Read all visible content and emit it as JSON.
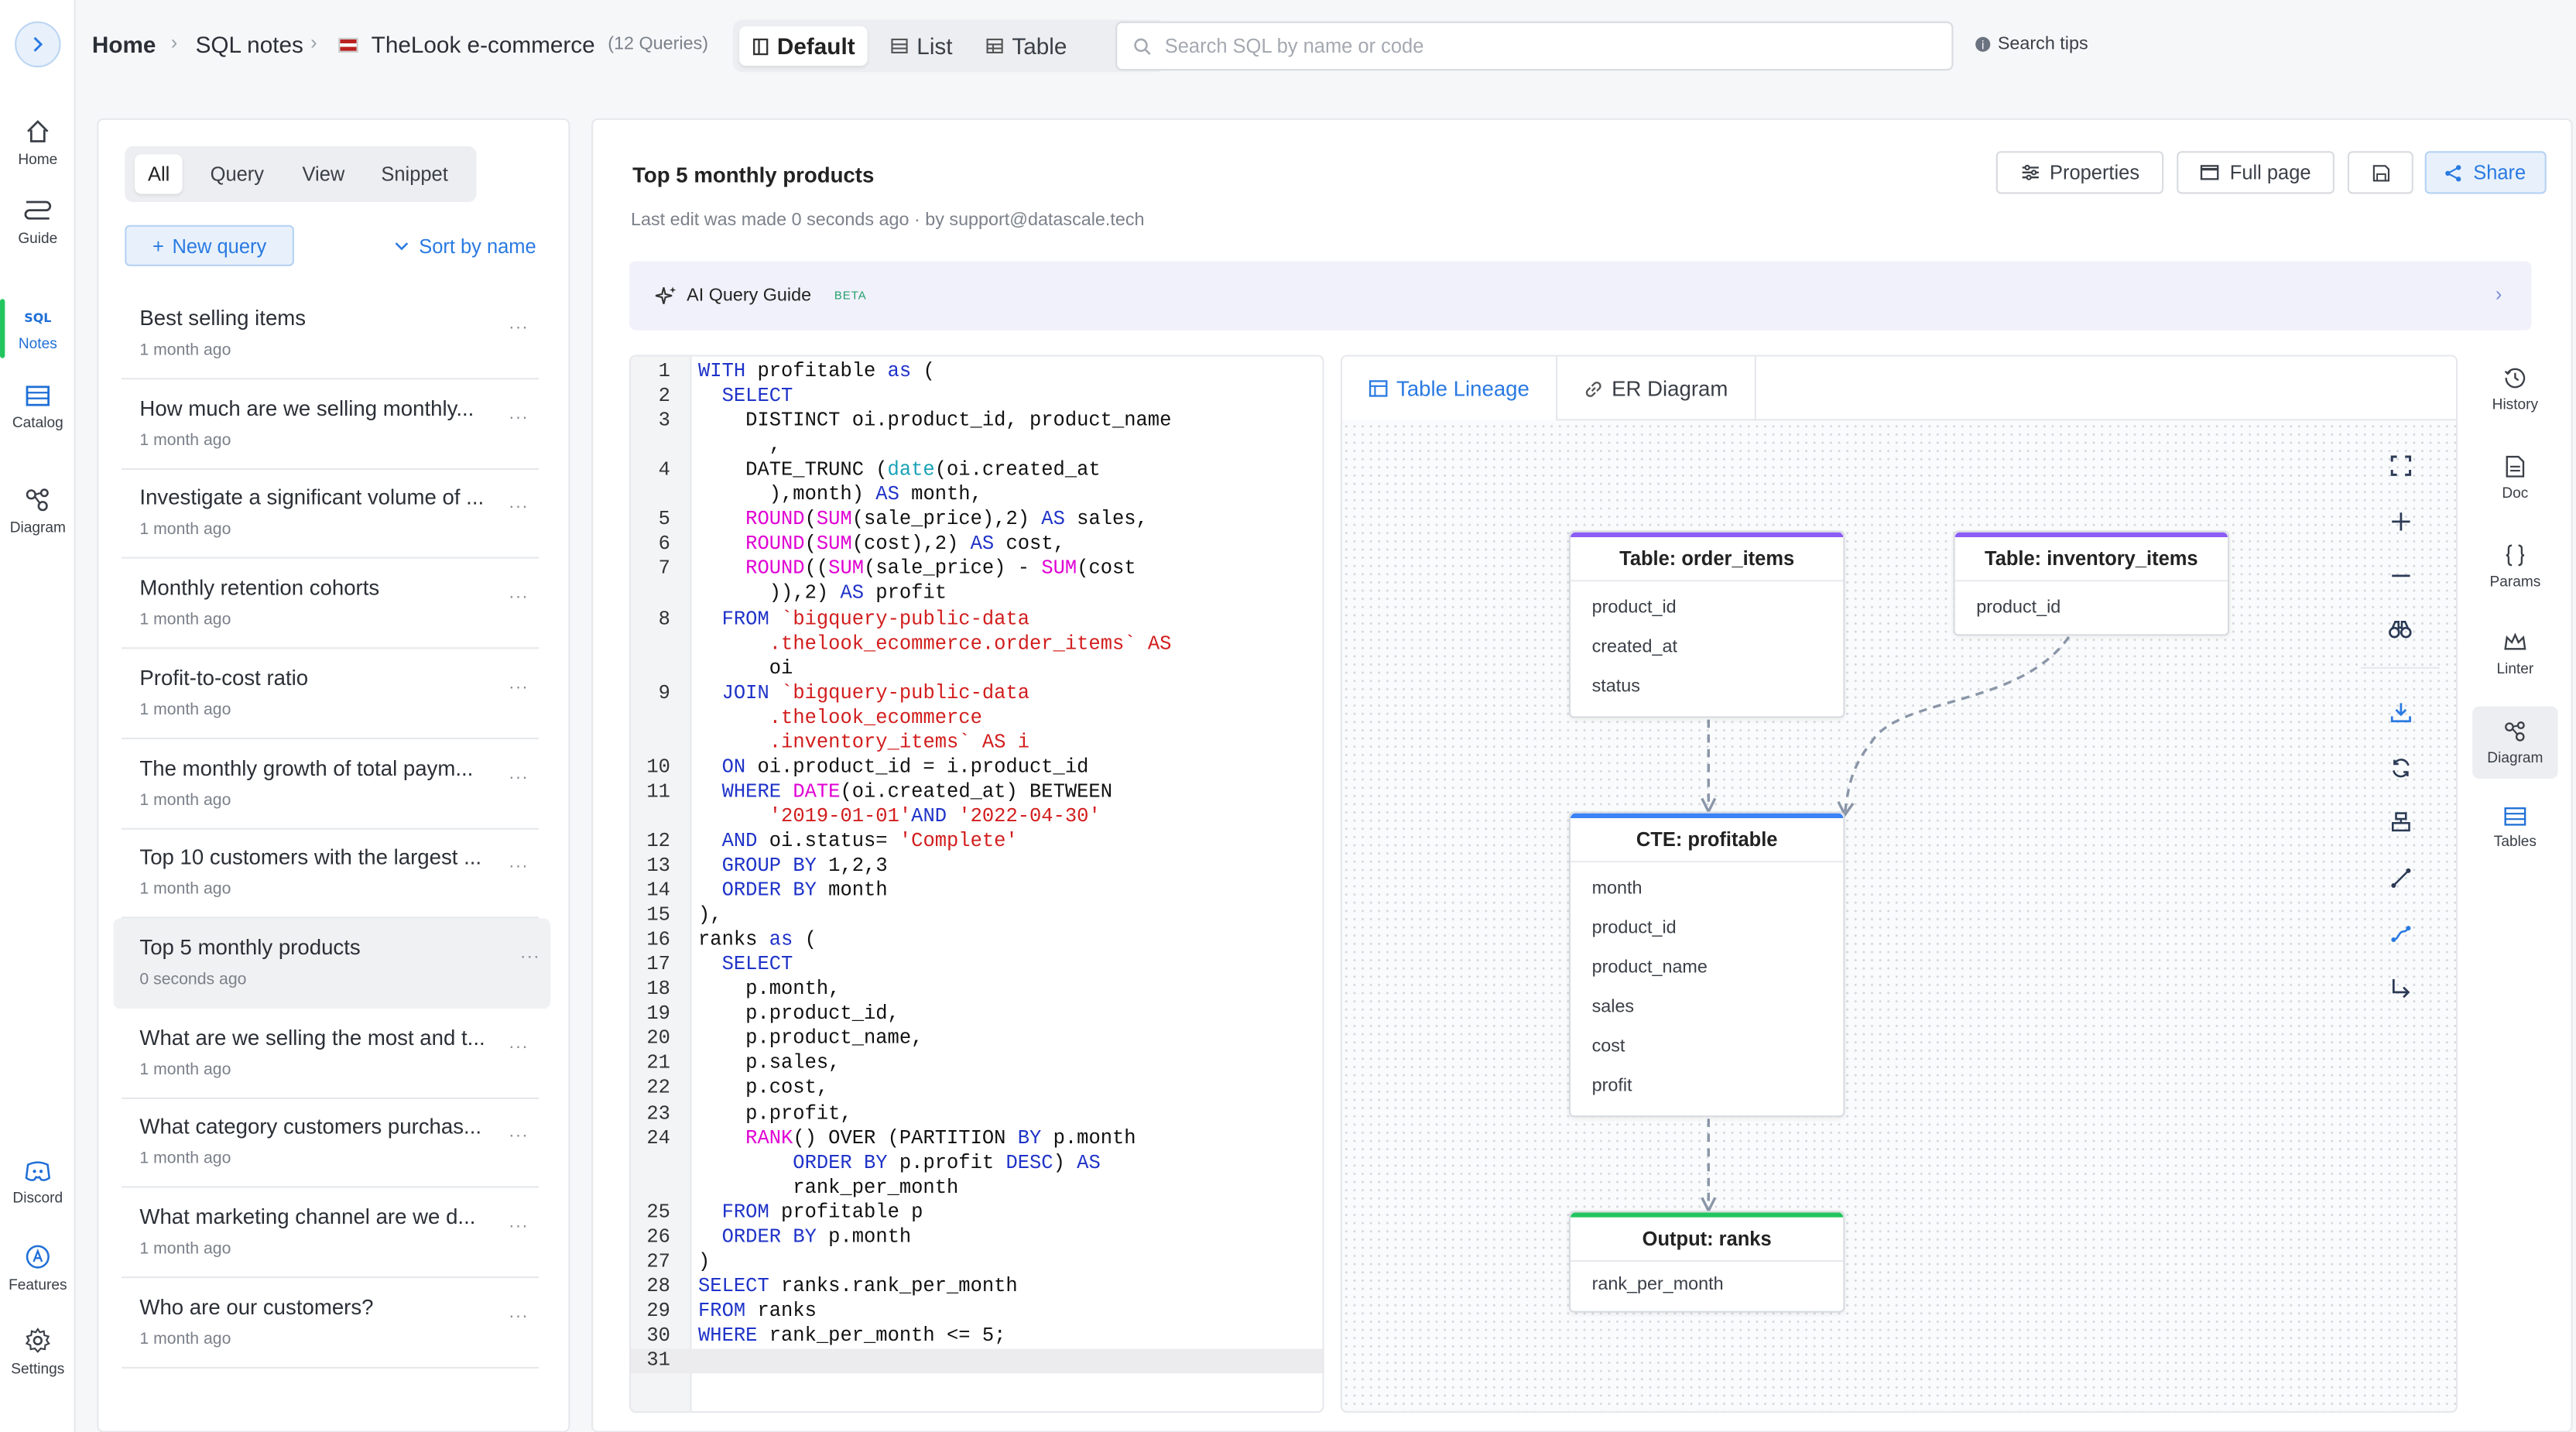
{
  "rail": {
    "items": [
      {
        "label": "Home"
      },
      {
        "label": "Guide"
      },
      {
        "label": "Notes"
      },
      {
        "label": "Catalog"
      },
      {
        "label": "Diagram"
      },
      {
        "label": "Discord"
      },
      {
        "label": "Features"
      },
      {
        "label": "Settings"
      }
    ],
    "notes_icon_text": "SQL"
  },
  "breadcrumb": {
    "home": "Home",
    "section": "SQL notes",
    "project": "TheLook e-commerce",
    "count": "(12 Queries)"
  },
  "views": {
    "default": "Default",
    "list": "List",
    "table": "Table"
  },
  "search": {
    "placeholder": "Search SQL by name or code",
    "tips": "Search tips"
  },
  "filters": {
    "all": "All",
    "query": "Query",
    "view": "View",
    "snippet": "Snippet"
  },
  "list": {
    "new_query": "New query",
    "sort": "Sort by name",
    "more": "...",
    "items": [
      {
        "title": "Best selling items",
        "time": "1 month ago"
      },
      {
        "title": "How much are we selling monthly...",
        "time": "1 month ago"
      },
      {
        "title": "Investigate a significant volume of ...",
        "time": "1 month ago"
      },
      {
        "title": "Monthly retention cohorts",
        "time": "1 month ago"
      },
      {
        "title": "Profit-to-cost ratio",
        "time": "1 month ago"
      },
      {
        "title": "The monthly growth of total paym...",
        "time": "1 month ago"
      },
      {
        "title": "Top 10 customers with the largest ...",
        "time": "1 month ago"
      },
      {
        "title": "Top 5 monthly products",
        "time": "0 seconds ago"
      },
      {
        "title": "What are we selling the most and t...",
        "time": "1 month ago"
      },
      {
        "title": "What category customers purchas...",
        "time": "1 month ago"
      },
      {
        "title": "What marketing channel are we d...",
        "time": "1 month ago"
      },
      {
        "title": "Who are our customers?",
        "time": "1 month ago"
      }
    ]
  },
  "query": {
    "title": "Top 5 monthly products",
    "last_edit": "Last edit was made 0 seconds ago · by support@datascale.tech",
    "properties": "Properties",
    "full_page": "Full page",
    "share": "Share"
  },
  "ai": {
    "label": "AI Query Guide",
    "badge": "BETA"
  },
  "code": {
    "current_line": "31",
    "lines": [
      {
        "n": "1",
        "t": "WITH profitable as ("
      },
      {
        "n": "2",
        "t": "  SELECT"
      },
      {
        "n": "3",
        "t": "    DISTINCT oi.product_id, product_name"
      },
      {
        "n": "",
        "t": "      ,"
      },
      {
        "n": "4",
        "t": "    DATE_TRUNC (date(oi.created_at"
      },
      {
        "n": "",
        "t": "      ),month) AS month,"
      },
      {
        "n": "5",
        "t": "    ROUND(SUM(sale_price),2) AS sales,"
      },
      {
        "n": "6",
        "t": "    ROUND(SUM(cost),2) AS cost,"
      },
      {
        "n": "7",
        "t": "    ROUND((SUM(sale_price) - SUM(cost"
      },
      {
        "n": "",
        "t": "      )),2) AS profit"
      },
      {
        "n": "8",
        "t": "  FROM `bigquery-public-data"
      },
      {
        "n": "",
        "t": "      .thelook_ecommerce.order_items` AS"
      },
      {
        "n": "",
        "t": "      oi"
      },
      {
        "n": "9",
        "t": "  JOIN `bigquery-public-data"
      },
      {
        "n": "",
        "t": "      .thelook_ecommerce"
      },
      {
        "n": "",
        "t": "      .inventory_items` AS i"
      },
      {
        "n": "10",
        "t": "  ON oi.product_id = i.product_id"
      },
      {
        "n": "11",
        "t": "  WHERE DATE(oi.created_at) BETWEEN"
      },
      {
        "n": "",
        "t": "      '2019-01-01'AND '2022-04-30'"
      },
      {
        "n": "12",
        "t": "  AND oi.status= 'Complete'"
      },
      {
        "n": "13",
        "t": "  GROUP BY 1,2,3"
      },
      {
        "n": "14",
        "t": "  ORDER BY month"
      },
      {
        "n": "15",
        "t": "),"
      },
      {
        "n": "16",
        "t": "ranks as ("
      },
      {
        "n": "17",
        "t": "  SELECT"
      },
      {
        "n": "18",
        "t": "    p.month,"
      },
      {
        "n": "19",
        "t": "    p.product_id,"
      },
      {
        "n": "20",
        "t": "    p.product_name,"
      },
      {
        "n": "21",
        "t": "    p.sales,"
      },
      {
        "n": "22",
        "t": "    p.cost,"
      },
      {
        "n": "23",
        "t": "    p.profit,"
      },
      {
        "n": "24",
        "t": "    RANK() OVER (PARTITION BY p.month"
      },
      {
        "n": "",
        "t": "        ORDER BY p.profit DESC) AS"
      },
      {
        "n": "",
        "t": "        rank_per_month"
      },
      {
        "n": "25",
        "t": "  FROM profitable p"
      },
      {
        "n": "26",
        "t": "  ORDER BY p.month"
      },
      {
        "n": "27",
        "t": ")"
      },
      {
        "n": "28",
        "t": "SELECT ranks.rank_per_month"
      },
      {
        "n": "29",
        "t": "FROM ranks"
      },
      {
        "n": "30",
        "t": "WHERE rank_per_month <= 5;"
      },
      {
        "n": "31",
        "t": ""
      }
    ]
  },
  "diagram": {
    "tab_lineage": "Table Lineage",
    "tab_er": "ER Diagram",
    "tables": [
      {
        "title": "Table: order_items",
        "cols": [
          "product_id",
          "created_at",
          "status"
        ],
        "accent": "#8b5cf6"
      },
      {
        "title": "Table: inventory_items",
        "cols": [
          "product_id"
        ],
        "accent": "#8b5cf6"
      },
      {
        "title": "CTE: profitable",
        "cols": [
          "month",
          "product_id",
          "product_name",
          "sales",
          "cost",
          "profit"
        ],
        "accent": "#3b82f6"
      },
      {
        "title": "Output: ranks",
        "cols": [
          "rank_per_month"
        ],
        "accent": "#22c55e"
      }
    ]
  },
  "right_rail": {
    "items": [
      {
        "label": "History"
      },
      {
        "label": "Doc"
      },
      {
        "label": "Params"
      },
      {
        "label": "Linter"
      },
      {
        "label": "Diagram"
      },
      {
        "label": "Tables"
      }
    ]
  },
  "colors": {
    "accent": "#2a7ae2",
    "keyword": "#1f33c8",
    "function": "#e000d4",
    "string": "#d21d1d"
  }
}
